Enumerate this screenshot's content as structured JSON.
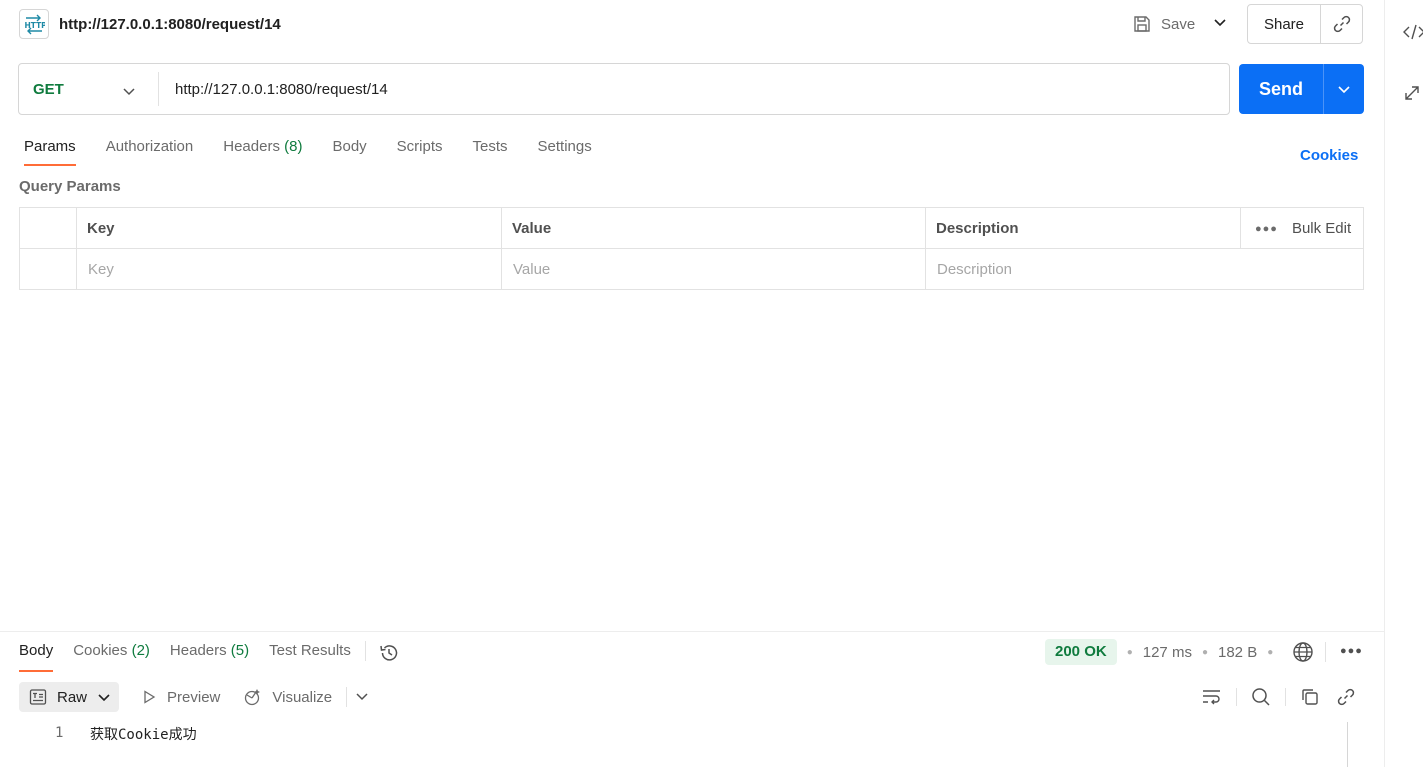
{
  "header": {
    "badge_text": "HTTP",
    "title": "http://127.0.0.1:8080/request/14",
    "save_label": "Save",
    "share_label": "Share"
  },
  "request": {
    "method": "GET",
    "url": "http://127.0.0.1:8080/request/14",
    "send_label": "Send"
  },
  "tabs": [
    {
      "label": "Params",
      "count": ""
    },
    {
      "label": "Authorization",
      "count": ""
    },
    {
      "label": "Headers",
      "count": "(8)"
    },
    {
      "label": "Body",
      "count": ""
    },
    {
      "label": "Scripts",
      "count": ""
    },
    {
      "label": "Tests",
      "count": ""
    },
    {
      "label": "Settings",
      "count": ""
    }
  ],
  "cookies_link": "Cookies",
  "query_params": {
    "title": "Query Params",
    "headers": {
      "key": "Key",
      "value": "Value",
      "description": "Description",
      "bulk_edit": "Bulk Edit"
    },
    "placeholders": {
      "key": "Key",
      "value": "Value",
      "description": "Description"
    }
  },
  "response": {
    "tabs": [
      {
        "label": "Body",
        "count": ""
      },
      {
        "label": "Cookies",
        "count": "(2)"
      },
      {
        "label": "Headers",
        "count": "(5)"
      },
      {
        "label": "Test Results",
        "count": ""
      }
    ],
    "status": "200 OK",
    "time": "127 ms",
    "size": "182 B",
    "format": {
      "raw": "Raw",
      "preview": "Preview",
      "visualize": "Visualize"
    },
    "body_lines": [
      {
        "number": "1",
        "text": "获取Cookie成功"
      }
    ]
  },
  "colors": {
    "accent": "#ff6c37",
    "send": "#0b6ff5",
    "method_get": "#0f7b3e",
    "status_ok": "#0f7b3e"
  }
}
